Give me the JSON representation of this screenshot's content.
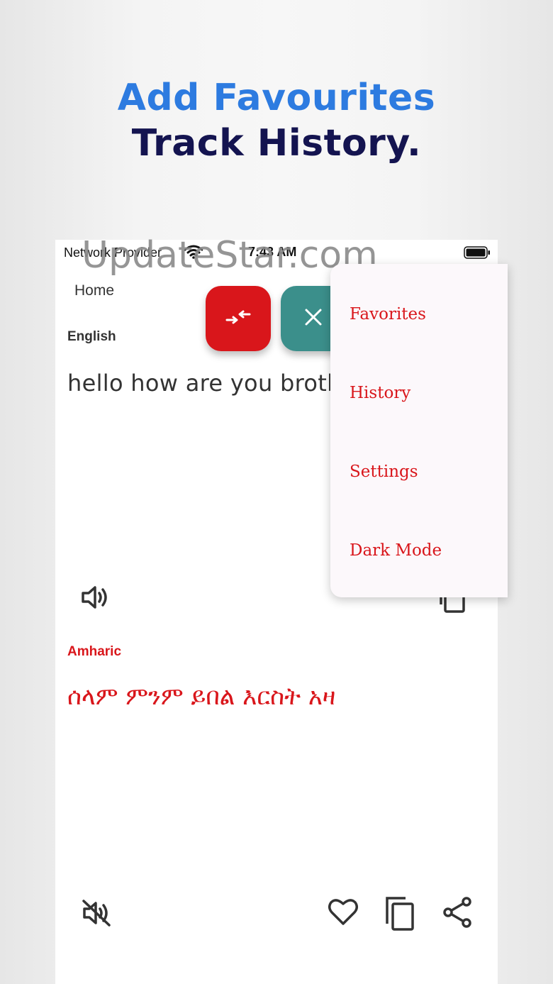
{
  "headline": {
    "line1": "Add Favourites",
    "line2": "Track History."
  },
  "status_bar": {
    "carrier": "Network Provider",
    "time": "7:43 AM"
  },
  "app": {
    "title": "Home",
    "source_language": "English",
    "source_text": "hello how are you broth",
    "target_language": "Amharic",
    "target_text": "ሰላም ምንም ይበል እርስት አዛ"
  },
  "watermark": "UpdateStar.com",
  "menu": {
    "items": [
      {
        "label": "Favorites"
      },
      {
        "label": "History"
      },
      {
        "label": "Settings"
      },
      {
        "label": "Dark Mode"
      }
    ]
  },
  "colors": {
    "accent_red": "#d9161b",
    "teal": "#3b8f8b",
    "headline_blue": "#2d7be0",
    "headline_navy": "#141450"
  },
  "icons": {
    "swap": "swap-arrows-icon",
    "close": "close-icon",
    "speaker": "speaker-icon",
    "mute": "mute-icon",
    "favorite": "heart-icon",
    "copy": "copy-icon",
    "share": "share-icon"
  }
}
